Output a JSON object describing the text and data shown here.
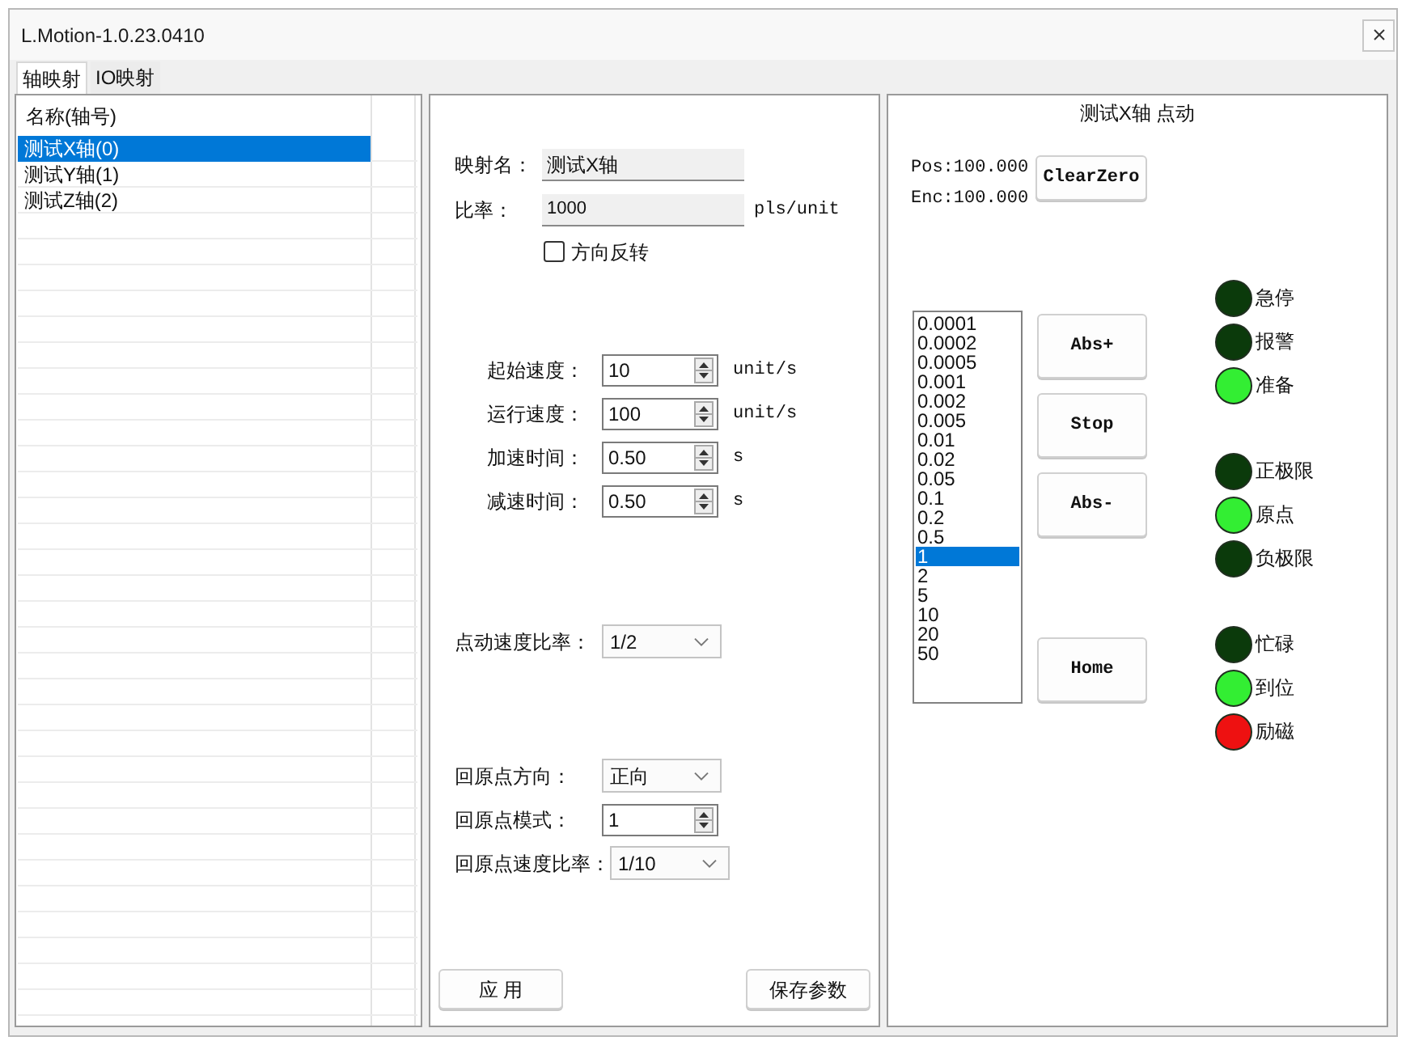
{
  "window": {
    "title": "L.Motion-1.0.23.0410"
  },
  "tabs": [
    {
      "label": "轴映射",
      "selected": true
    },
    {
      "label": "IO映射",
      "selected": false
    }
  ],
  "axis_list": {
    "header": "名称(轴号)",
    "rows": [
      {
        "name": "测试X轴(0)",
        "selected": true
      },
      {
        "name": "测试Y轴(1)",
        "selected": false
      },
      {
        "name": "测试Z轴(2)",
        "selected": false
      }
    ]
  },
  "mapping": {
    "name": {
      "label": "映射名：",
      "value": "测试X轴"
    },
    "ratio": {
      "label": "比率：",
      "value": "1000",
      "unit": "pls/unit"
    },
    "reverse": {
      "label": "方向反转",
      "checked": false
    }
  },
  "motion": [
    {
      "label": "起始速度：",
      "value": "10",
      "unit": "unit/s"
    },
    {
      "label": "运行速度：",
      "value": "100",
      "unit": "unit/s"
    },
    {
      "label": "加速时间：",
      "value": "0.50",
      "unit": "s"
    },
    {
      "label": "减速时间：",
      "value": "0.50",
      "unit": "s"
    }
  ],
  "jog_ratio": {
    "label": "点动速度比率：",
    "value": "1/2"
  },
  "homing": [
    {
      "kind": "combo",
      "label": "回原点方向：",
      "value": "正向"
    },
    {
      "kind": "spin",
      "label": "回原点模式：",
      "value": "1"
    },
    {
      "kind": "combo",
      "label": "回原点速度比率：",
      "value": "1/10"
    }
  ],
  "actions": [
    "应 用",
    "保存参数"
  ],
  "jog": {
    "title": "测试X轴 点动",
    "pos": "Pos:100.000",
    "enc": "Enc:100.000",
    "clear": "ClearZero",
    "steps": [
      {
        "label": "0.0001",
        "selected": false
      },
      {
        "label": "0.0002",
        "selected": false
      },
      {
        "label": "0.0005",
        "selected": false
      },
      {
        "label": "0.001",
        "selected": false
      },
      {
        "label": "0.002",
        "selected": false
      },
      {
        "label": "0.005",
        "selected": false
      },
      {
        "label": "0.01",
        "selected": false
      },
      {
        "label": "0.02",
        "selected": false
      },
      {
        "label": "0.05",
        "selected": false
      },
      {
        "label": "0.1",
        "selected": false
      },
      {
        "label": "0.2",
        "selected": false
      },
      {
        "label": "0.5",
        "selected": false
      },
      {
        "label": "1",
        "selected": true
      },
      {
        "label": "2",
        "selected": false
      },
      {
        "label": "5",
        "selected": false
      },
      {
        "label": "10",
        "selected": false
      },
      {
        "label": "20",
        "selected": false
      },
      {
        "label": "50",
        "selected": false
      }
    ],
    "move_buttons": [
      "Abs+",
      "Stop",
      "Abs-"
    ],
    "home_button": "Home",
    "indicator_groups": [
      {
        "items": [
          {
            "label": "急停",
            "color": "#0b3a0b"
          },
          {
            "label": "报警",
            "color": "#0b3a0b"
          },
          {
            "label": "准备",
            "color": "#33ee33"
          }
        ]
      },
      {
        "items": [
          {
            "label": "正极限",
            "color": "#0b3a0b"
          },
          {
            "label": "原点",
            "color": "#33ee33"
          },
          {
            "label": "负极限",
            "color": "#0b3a0b"
          }
        ]
      },
      {
        "items": [
          {
            "label": "忙碌",
            "color": "#0b3a0b"
          },
          {
            "label": "到位",
            "color": "#33ee33"
          },
          {
            "label": "励磁",
            "color": "#ee1111"
          }
        ]
      }
    ]
  }
}
